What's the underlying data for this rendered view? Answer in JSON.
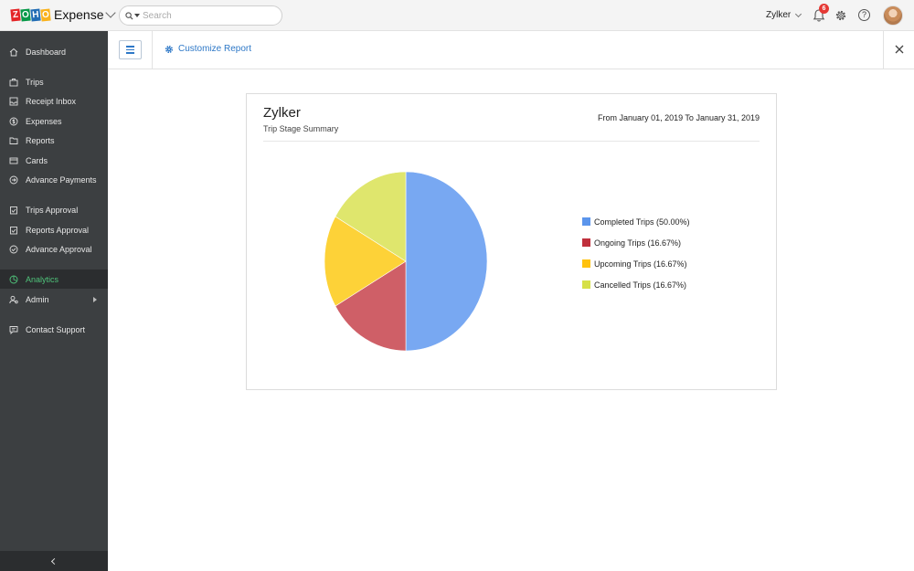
{
  "app": {
    "brand_letters": [
      "Z",
      "O",
      "H",
      "O"
    ],
    "brand_colors": [
      "#e42527",
      "#089949",
      "#226db4",
      "#f9b21d"
    ],
    "product": "Expense"
  },
  "search": {
    "placeholder": "Search"
  },
  "header": {
    "org_name": "Zylker",
    "notification_count": "6",
    "help_glyph": "?"
  },
  "toolbar": {
    "customize_label": "Customize Report"
  },
  "sidebar": {
    "items": [
      {
        "label": "Dashboard",
        "icon": "home-icon"
      },
      {
        "label": "Trips",
        "icon": "suitcase-icon"
      },
      {
        "label": "Receipt Inbox",
        "icon": "inbox-icon"
      },
      {
        "label": "Expenses",
        "icon": "dollar-icon"
      },
      {
        "label": "Reports",
        "icon": "folder-icon"
      },
      {
        "label": "Cards",
        "icon": "card-icon"
      },
      {
        "label": "Advance Payments",
        "icon": "advance-icon"
      },
      {
        "label": "Trips Approval",
        "icon": "approval-icon"
      },
      {
        "label": "Reports Approval",
        "icon": "approval-icon"
      },
      {
        "label": "Advance Approval",
        "icon": "check-circle-icon"
      },
      {
        "label": "Analytics",
        "icon": "analytics-icon",
        "active": true
      },
      {
        "label": "Admin",
        "icon": "admin-icon",
        "has_submenu": true
      },
      {
        "label": "Contact Support",
        "icon": "chat-icon"
      }
    ]
  },
  "report": {
    "org": "Zylker",
    "subtitle": "Trip Stage Summary",
    "date_range": "From January 01, 2019 To January 31, 2019"
  },
  "chart_data": {
    "type": "pie",
    "slices": [
      {
        "label": "Completed Trips (50.00%)",
        "value": 50.0,
        "color": "#78a8f2",
        "legend_color": "#5b95ec"
      },
      {
        "label": "Ongoing Trips (16.67%)",
        "value": 16.67,
        "color": "#cf5f67",
        "legend_color": "#c0303c"
      },
      {
        "label": "Upcoming Trips (16.67%)",
        "value": 16.67,
        "color": "#fdd238",
        "legend_color": "#ffc20e"
      },
      {
        "label": "Cancelled Trips (16.67%)",
        "value": 16.67,
        "color": "#dfe66d",
        "legend_color": "#d6e047"
      }
    ]
  }
}
